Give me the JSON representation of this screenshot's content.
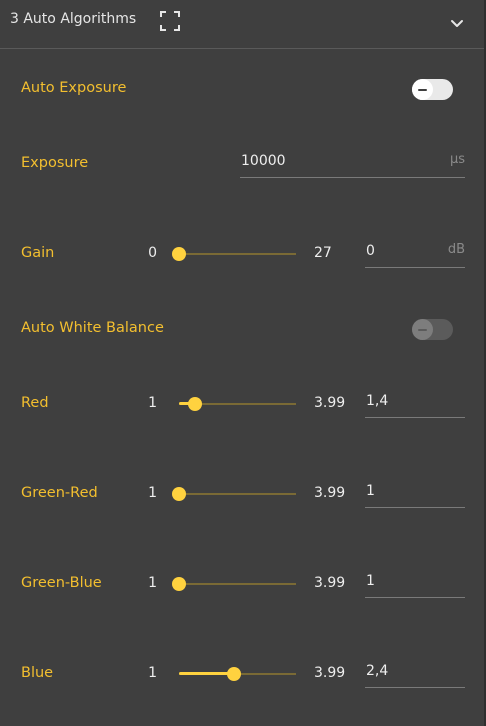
{
  "header": {
    "title": "3 Auto Algorithms"
  },
  "icons": {
    "expand": "expand-corners-icon",
    "collapse": "chevron-down-icon"
  },
  "colors": {
    "accent": "#ffd23f",
    "label": "#f3bf2f",
    "background": "#3f3f3f"
  },
  "auto_exposure": {
    "label": "Auto Exposure",
    "enabled": true
  },
  "exposure": {
    "label": "Exposure",
    "value": "10000",
    "unit": "µs"
  },
  "gain": {
    "label": "Gain",
    "min": "0",
    "max": "27",
    "value": "0",
    "unit": "dB",
    "level": 0
  },
  "auto_white_balance": {
    "label": "Auto White Balance",
    "enabled": false
  },
  "red": {
    "label": "Red",
    "min": "1",
    "max": "3.99",
    "value": "1,4",
    "level": 0.134
  },
  "green_red": {
    "label": "Green-Red",
    "min": "1",
    "max": "3.99",
    "value": "1",
    "level": 0
  },
  "green_blue": {
    "label": "Green-Blue",
    "min": "1",
    "max": "3.99",
    "value": "1",
    "level": 0
  },
  "blue": {
    "label": "Blue",
    "min": "1",
    "max": "3.99",
    "value": "2,4",
    "level": 0.468
  }
}
